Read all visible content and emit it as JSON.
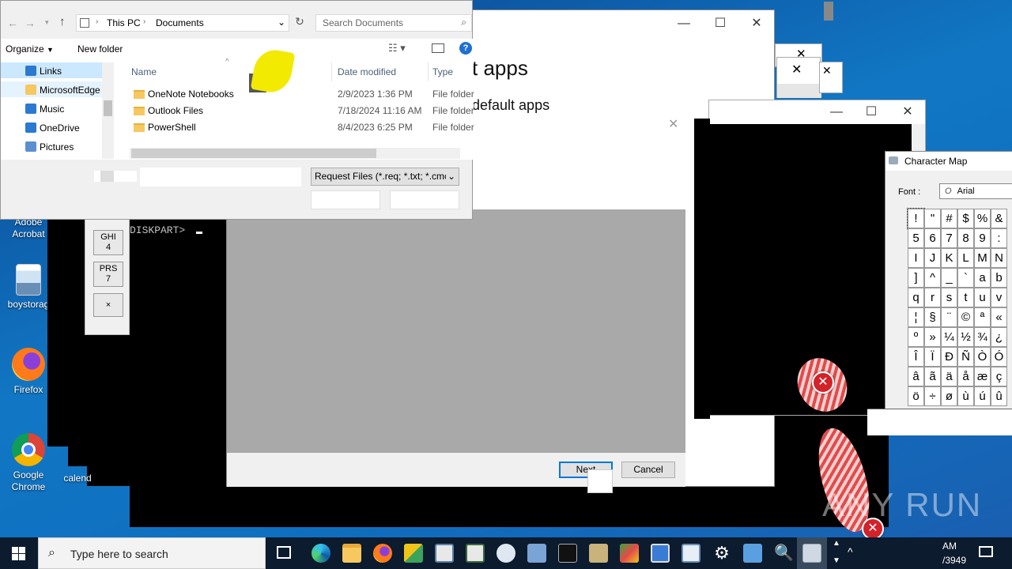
{
  "explorer": {
    "breadcrumb": [
      "This PC",
      "Documents"
    ],
    "search_placeholder": "Search Documents",
    "toolbar": {
      "organize": "Organize",
      "new_folder": "New folder"
    },
    "nav": [
      {
        "label": "Links",
        "icon": "links-icon",
        "color": "#2b79d0"
      },
      {
        "label": "MicrosoftEdge",
        "icon": "folder-icon",
        "color": "#f6c85f"
      },
      {
        "label": "Music",
        "icon": "music-icon",
        "color": "#2b79d0"
      },
      {
        "label": "OneDrive",
        "icon": "onedrive-icon",
        "color": "#2b79d0"
      },
      {
        "label": "Pictures",
        "icon": "pictures-icon",
        "color": "#5a8fd0"
      }
    ],
    "columns": {
      "name": "Name",
      "date": "Date modified",
      "type": "Type"
    },
    "files": [
      {
        "name": "OneNote Notebooks",
        "date": "2/9/2023 1:36 PM",
        "type": "File folder"
      },
      {
        "name": "Outlook Files",
        "date": "7/18/2024 11:16 AM",
        "type": "File folder"
      },
      {
        "name": "PowerShell",
        "date": "8/4/2023 6:25 PM",
        "type": "File folder"
      }
    ],
    "file_type_filter": "Request Files (*.req; *.txt; *.cmc"
  },
  "settings_window": {
    "title_fragment": "t apps",
    "subtitle_fragment": "default apps",
    "next_button": "Next",
    "cancel_button": "Cancel"
  },
  "console": {
    "prompt": "DISKPART>"
  },
  "keypad": {
    "keys": [
      "GHI\n4",
      "PRS\n7",
      "×"
    ]
  },
  "character_map": {
    "title": "Character Map",
    "font_label": "Font :",
    "font_value": "Arial",
    "rows": [
      [
        "!",
        "\"",
        "#",
        "$",
        "%",
        "&"
      ],
      [
        "5",
        "6",
        "7",
        "8",
        "9",
        ":"
      ],
      [
        "I",
        "J",
        "K",
        "L",
        "M",
        "N"
      ],
      [
        "]",
        "^",
        "_",
        "`",
        "a",
        "b"
      ],
      [
        "q",
        "r",
        "s",
        "t",
        "u",
        "v"
      ],
      [
        "¦",
        "§",
        "¨",
        "©",
        "ª",
        "«"
      ],
      [
        "º",
        "»",
        "¼",
        "½",
        "¾",
        "¿"
      ],
      [
        "Î",
        "Ï",
        "Ð",
        "Ñ",
        "Ò",
        "Ó"
      ],
      [
        "â",
        "ã",
        "ä",
        "å",
        "æ",
        "ç"
      ],
      [
        "ö",
        "÷",
        "ø",
        "ù",
        "ú",
        "û"
      ]
    ]
  },
  "desktop_icons": [
    {
      "label": "Adobe\nAcrobat",
      "icon": "acrobat-icon"
    },
    {
      "label": "boystorag",
      "icon": "image-file-icon"
    },
    {
      "label": "Firefox",
      "icon": "firefox-icon"
    },
    {
      "label": "Google\nChrome",
      "icon": "chrome-icon"
    },
    {
      "label": "calend",
      "icon": "calendar-icon"
    }
  ],
  "taskbar": {
    "search_placeholder": "Type here to search",
    "clock_time": "AM",
    "clock_date": "/3949"
  },
  "watermark": "ANY RUN",
  "colors": {
    "accent": "#0078d7",
    "taskbar": "#0c1b2e",
    "error": "#d2232a"
  }
}
